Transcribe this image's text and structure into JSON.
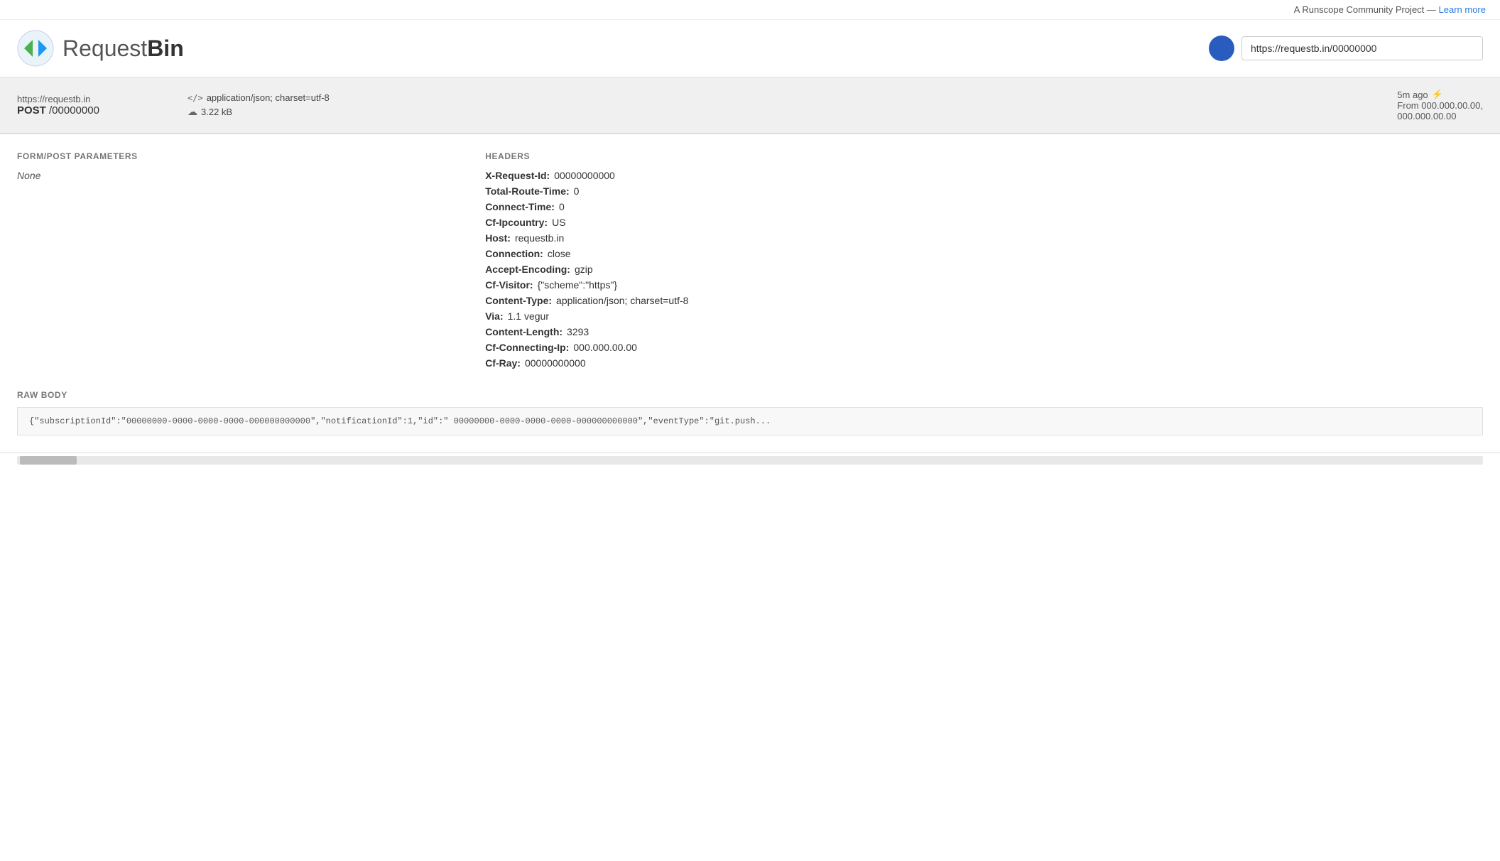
{
  "top_banner": {
    "text": "A Runscope Community Project — ",
    "link_label": "Learn more",
    "link_href": "#"
  },
  "header": {
    "logo_text_light": "Request",
    "logo_text_bold": "Bin",
    "bin_url": "https://requestb.in/00000000"
  },
  "request": {
    "url_base": "https://requestb.in",
    "method": "POST",
    "path": "/00000000",
    "content_type": "application/json; charset=utf-8",
    "size": "3.22 kB",
    "time_ago": "5m ago",
    "from_label": "From 000.000.00.00,",
    "from_ip2": "000.000.00.00"
  },
  "sections": {
    "form_post_params": {
      "title": "FORM/POST PARAMETERS",
      "value": "None"
    },
    "headers": {
      "title": "HEADERS",
      "items": [
        {
          "key": "X-Request-Id:",
          "value": "00000000000"
        },
        {
          "key": "Total-Route-Time:",
          "value": "0"
        },
        {
          "key": "Connect-Time:",
          "value": "0"
        },
        {
          "key": "Cf-Ipcountry:",
          "value": "US"
        },
        {
          "key": "Host:",
          "value": "requestb.in"
        },
        {
          "key": "Connection:",
          "value": "close"
        },
        {
          "key": "Accept-Encoding:",
          "value": "gzip"
        },
        {
          "key": "Cf-Visitor:",
          "value": "{\"scheme\":\"https\"}"
        },
        {
          "key": "Content-Type:",
          "value": "application/json; charset=utf-8"
        },
        {
          "key": "Via:",
          "value": "1.1 vegur"
        },
        {
          "key": "Content-Length:",
          "value": "3293"
        },
        {
          "key": "Cf-Connecting-Ip:",
          "value": "000.000.00.00"
        },
        {
          "key": "Cf-Ray:",
          "value": "00000000000"
        }
      ]
    },
    "raw_body": {
      "title": "RAW BODY",
      "content": "{\"subscriptionId\":\"00000000-0000-0000-0000-000000000000\",\"notificationId\":1,\"id\":\" 00000000-0000-0000-0000-000000000000\",\"eventType\":\"git.push..."
    }
  }
}
